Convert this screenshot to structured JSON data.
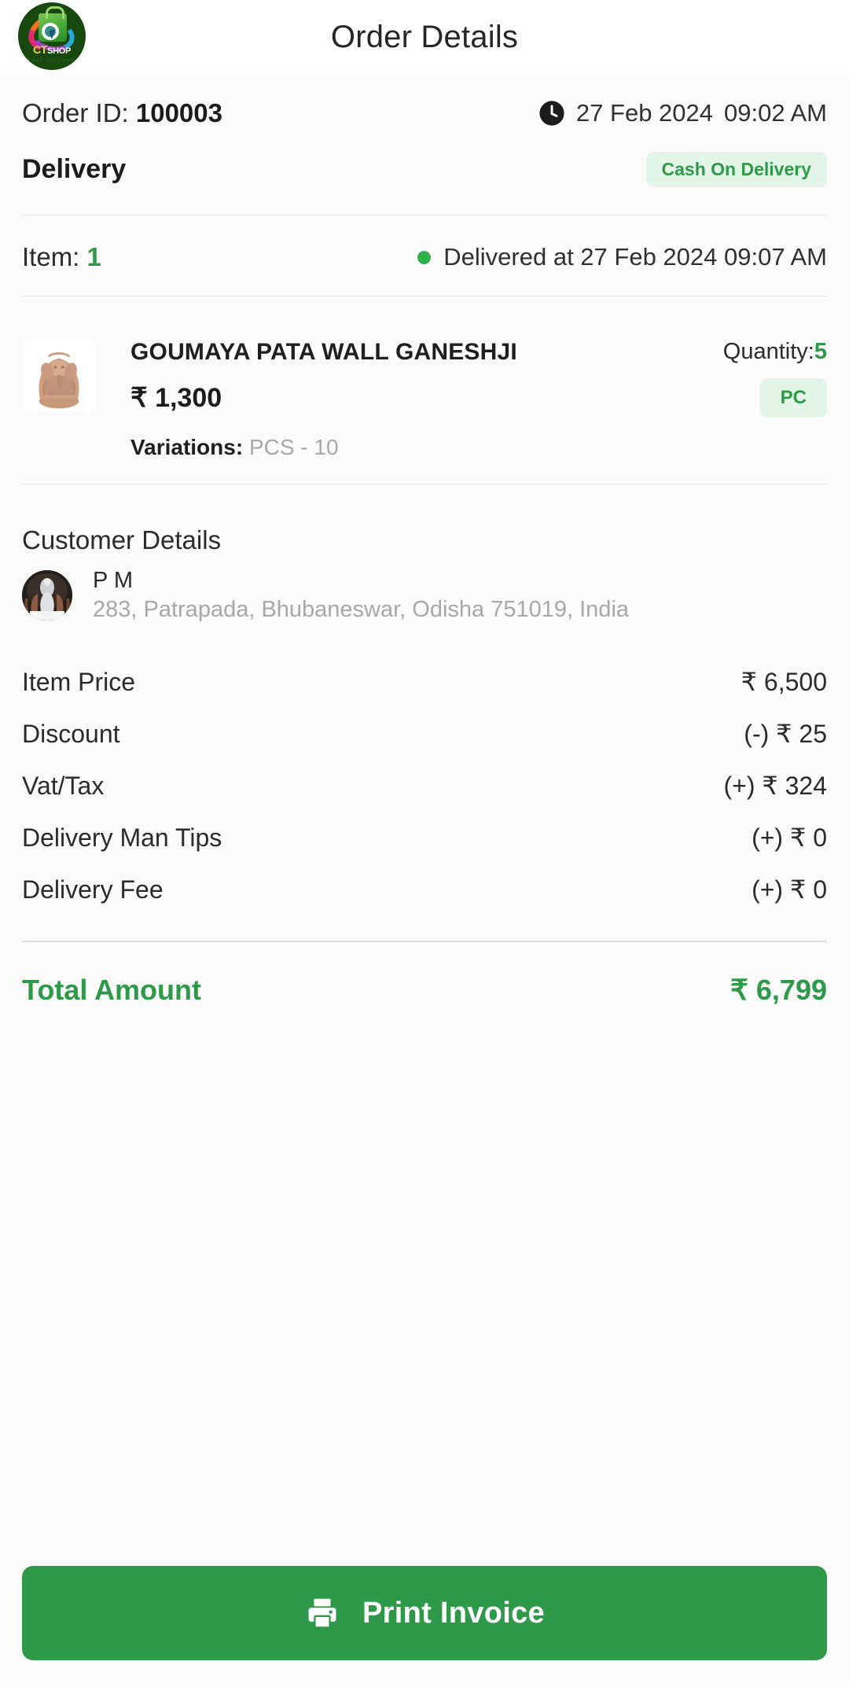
{
  "header": {
    "title": "Order Details",
    "logo": {
      "wordmark_ct": "CT",
      "wordmark_shop": "SHOP",
      "tagline": "EASY SOLUTION"
    }
  },
  "order": {
    "id_label": "Order ID:",
    "id_value": "100003",
    "placed_date": "27 Feb 2024",
    "placed_time": "09:02 AM",
    "delivery_type": "Delivery",
    "payment_method": "Cash On Delivery",
    "item_label": "Item:",
    "item_count": "1",
    "status_text": "Delivered at 27 Feb 2024  09:07 AM"
  },
  "product": {
    "name": "GOUMAYA PATA WALL GANESHJI",
    "price": "₹ 1,300",
    "quantity_label": "Quantity:",
    "quantity_value": "5",
    "unit_badge": "PC",
    "variations_label": "Variations:",
    "variations_value": "PCS - 10"
  },
  "customer": {
    "section_title": "Customer Details",
    "name": "P M",
    "address": "283, Patrapada, Bhubaneswar, Odisha 751019, India"
  },
  "summary": {
    "rows": [
      {
        "label": "Item Price",
        "value": "₹ 6,500"
      },
      {
        "label": "Discount",
        "value": "(-) ₹ 25"
      },
      {
        "label": "Vat/Tax",
        "value": "(+) ₹ 324"
      },
      {
        "label": "Delivery Man Tips",
        "value": "(+) ₹ 0"
      },
      {
        "label": "Delivery Fee",
        "value": "(+) ₹ 0"
      }
    ],
    "total_label": "Total Amount",
    "total_value": "₹ 6,799"
  },
  "footer": {
    "print_label": "Print Invoice"
  },
  "colors": {
    "accent_green": "#2e9949",
    "badge_bg": "#e3f4e8",
    "status_dot": "#2eb34a",
    "page_bg": "#fafafa",
    "muted_text": "#a8a8a8"
  }
}
